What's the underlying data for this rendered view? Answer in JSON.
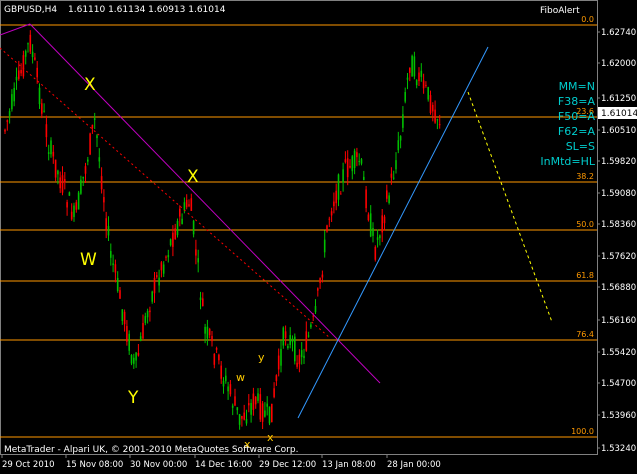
{
  "header": {
    "symbol": "GBPUSD,H4",
    "quote": "1.61110 1.61134 1.60913 1.61014",
    "indicator": "FiboAlert"
  },
  "watermark": "MetaTrader - Alpari UK, © 2001-2010 MetaQuotes Software Corp.",
  "info_panel": [
    "MM=N",
    "F38=A",
    "F50=A",
    "F62=A",
    "SL=S",
    "InMtd=HL"
  ],
  "price_axis": {
    "ticks": [
      "1.62740",
      "1.62000",
      "1.61250",
      "1.60510",
      "1.59820",
      "1.59080",
      "1.58360",
      "1.57620",
      "1.56880",
      "1.56160",
      "1.55420",
      "1.54700",
      "1.53960",
      "1.53240"
    ],
    "current_price": "1.61014"
  },
  "time_axis": {
    "labels": [
      "29 Oct 2010",
      "15 Nov 08:00",
      "30 Nov 00:00",
      "14 Dec 16:00",
      "29 Dec 12:00",
      "13 Jan 08:00",
      "28 Jan 00:00"
    ]
  },
  "fibo_levels": [
    {
      "label": "0.0"
    },
    {
      "label": "23.6"
    },
    {
      "label": "38.2"
    },
    {
      "label": "50.0"
    },
    {
      "label": "61.8"
    },
    {
      "label": "76.4"
    },
    {
      "label": "100.0"
    }
  ],
  "wave_labels": [
    "X",
    "X",
    "W",
    "Y",
    "w",
    "y",
    "x",
    "x"
  ],
  "colors": {
    "background": "#000000",
    "bull_candle": "#00c000",
    "bear_candle": "#ff0000",
    "fibo_line": "#ff9900",
    "fibo_text": "#ff9900",
    "trend_magenta": "#c000c0",
    "trend_blue": "#3399ff",
    "projection_yellow": "#ffff00",
    "info_text": "#00cccc",
    "wave_text": "#ffff00",
    "axis_text": "#ffffff"
  }
}
